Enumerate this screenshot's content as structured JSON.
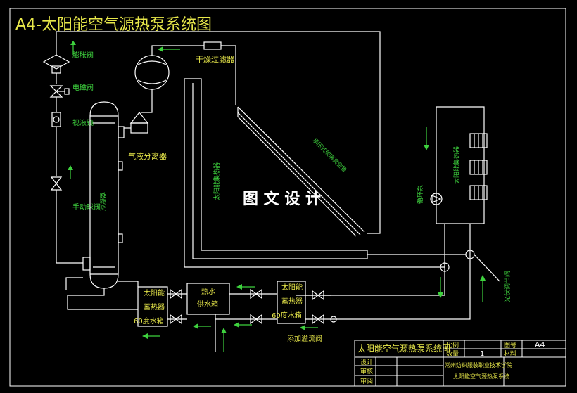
{
  "title": "A4-太阳能空气源热泵系统图",
  "watermark": "图 文 设 计",
  "colors": {
    "background": "#000000",
    "lines": "#ffffff",
    "title": "#e8e84a",
    "labels": "#3ed23e"
  },
  "labels": {
    "dryer_filter": "干燥过滤器",
    "expansion_valve": "膨胀阀",
    "solenoid_valve": "电磁阀",
    "sight_glass": "视液镜",
    "manual_valve": "手动球阀",
    "gas_liquid_separator": "气液分离器",
    "condenser": "冷凝器",
    "solar_collector": "太阳能集热器",
    "circulation_pump": "循环泵",
    "solar_heat_collector_right": "太阳能集热器",
    "solar_collector_diag": "承压式玻璃真空管",
    "storage_tank_left_1": "太阳能",
    "storage_tank_left_2": "蓄热器",
    "storage_tank_left_3": "60度水箱",
    "hot_water_tank_1": "热水",
    "hot_water_tank_2": "供水箱",
    "storage_tank_right_1": "太阳能",
    "storage_tank_right_2": "蓄热器",
    "storage_tank_right_3": "60度水箱",
    "makeup_valve": "添加溢流阀",
    "cold_water_valve": "光伏调节阀"
  },
  "title_block": {
    "name": "太阳能空气源热泵系统图",
    "scale_label": "比例",
    "qty_label": "数量",
    "qty_value": "1",
    "drawing_no_label": "图号",
    "drawing_no_value": "A4",
    "material_label": "材料",
    "design_label": "设计",
    "check_label": "审核",
    "approve_label": "审阅",
    "school": "常州纺织服装职业技术学院",
    "subtitle": "太阳能空气源热泵系统"
  }
}
